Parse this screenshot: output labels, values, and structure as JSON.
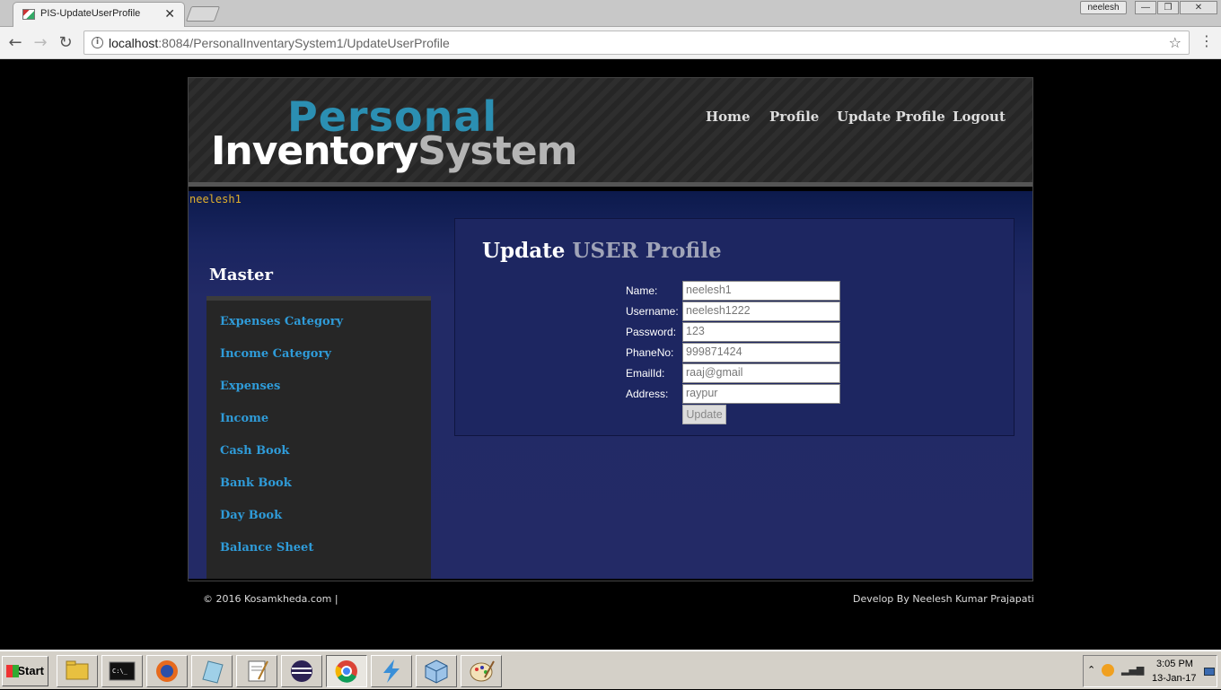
{
  "browser": {
    "tab_title": "PIS-UpdateUserProfile",
    "profile_name": "neelesh",
    "url_host": "localhost",
    "url_path": ":8084/PersonalInventarySystem1/UpdateUserProfile"
  },
  "header": {
    "logo_line1": "Personal",
    "logo_line2a": "Inventory",
    "logo_line2b": "System",
    "nav": [
      "Home",
      "Profile",
      "Update Profile",
      "Logout"
    ]
  },
  "user": {
    "username": "neelesh1"
  },
  "sidebar": {
    "title": "Master",
    "items": [
      "Expenses Category",
      "Income Category",
      "Expenses",
      "Income",
      "Cash Book",
      "Bank Book",
      "Day Book",
      "Balance Sheet"
    ]
  },
  "form": {
    "title_main": "Update",
    "title_sub": "USER Profile",
    "fields": [
      {
        "label": "Name:",
        "value": "neelesh1"
      },
      {
        "label": "Username:",
        "value": "neelesh1222"
      },
      {
        "label": "Password:",
        "value": "123"
      },
      {
        "label": "PhaneNo:",
        "value": "999871424"
      },
      {
        "label": "EmailId:",
        "value": "raaj@gmail"
      },
      {
        "label": "Address:",
        "value": "raypur"
      }
    ],
    "submit_label": "Update"
  },
  "footer": {
    "left": "© 2016 Kosamkheda.com |",
    "right": "Develop By Neelesh Kumar Prajapati"
  },
  "taskbar": {
    "start_label": "Start",
    "time": "3:05 PM",
    "date": "13-Jan-17",
    "apps": [
      "file-explorer-icon",
      "cmd-icon",
      "firefox-icon",
      "notepad-icon",
      "wordpad-icon",
      "eclipse-icon",
      "chrome-icon",
      "flash-icon",
      "virtualbox-icon",
      "paint-icon"
    ]
  },
  "colors": {
    "logo_blue": "#2b8fb2",
    "link_blue": "#2f9bd8",
    "username_gold": "#e2b12d",
    "content_navy": "#1d2661"
  }
}
